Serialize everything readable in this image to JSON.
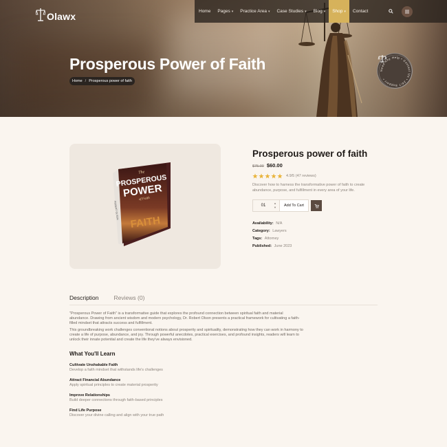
{
  "brand": {
    "name": "Olawx"
  },
  "nav": {
    "items": [
      {
        "label": "Home",
        "dropdown": false,
        "active": false
      },
      {
        "label": "Pages",
        "dropdown": true,
        "active": false
      },
      {
        "label": "Practice Area",
        "dropdown": true,
        "active": false
      },
      {
        "label": "Case Studies",
        "dropdown": true,
        "active": false
      },
      {
        "label": "Blog",
        "dropdown": true,
        "active": false
      },
      {
        "label": "Shop",
        "dropdown": true,
        "active": true
      },
      {
        "label": "Contact",
        "dropdown": false,
        "active": false
      }
    ],
    "search_icon": "search-icon",
    "menu_icon": "grid-menu-icon"
  },
  "hero": {
    "title": "Prosperous Power of Faith",
    "breadcrumb": {
      "home": "Home",
      "separator": "/",
      "current": "Prosperous power of faith"
    },
    "badge_text": "Need Any Help • Contact Us • 24/7 Support •"
  },
  "product": {
    "title": "Prosperous power of faith",
    "old_price": "$75.00",
    "new_price": "$60.00",
    "rating": {
      "stars": 5,
      "text": "4.9/5 (47 reviews)"
    },
    "description": "Discover how to harness the transformative power of faith to create abundance, purpose, and fulfillment in every area of your life.",
    "quantity": "01",
    "add_to_cart": "Add To Cart",
    "meta": {
      "availability": {
        "label": "Availability:",
        "value": "N/A"
      },
      "category": {
        "label": "Category:",
        "value": "Lawyers"
      },
      "tags": {
        "label": "Tags:",
        "value": "Attorney"
      },
      "published": {
        "label": "Published:",
        "value": "June 2023"
      }
    },
    "book": {
      "top": "The",
      "line1": "PROSPEROUS",
      "line2": "POWER",
      "line3": "of Faith",
      "line4": "FAITH",
      "side": "ROBERT OLSON"
    }
  },
  "tabs": [
    {
      "label": "Description",
      "active": true
    },
    {
      "label": "Reviews (0)",
      "active": false
    }
  ],
  "description": {
    "paragraphs": [
      "\"Prosperous Power of Faith\" is a transformative guide that explores the profound connection between spiritual faith and material abundance. Drawing from ancient wisdom and modern psychology, Dr. Robert Olson presents a practical framework for cultivating a faith-filled mindset that attracts success and fulfillment.",
      "This groundbreaking work challenges conventional notions about prosperity and spirituality, demonstrating how they can work in harmony to create a life of purpose, abundance, and joy. Through powerful anecdotes, practical exercises, and profound insights, readers will learn to unlock their innate potential and create the life they've always envisioned."
    ],
    "learn_heading": "What You'll Learn",
    "learn_items": [
      {
        "title": "Cultivate Unshakable Faith",
        "desc": "Develop a faith mindset that withstands life's challenges"
      },
      {
        "title": "Attract Financial Abundance",
        "desc": "Apply spiritual principles to create material prosperity"
      },
      {
        "title": "Improve Relationships",
        "desc": "Build deeper connections through faith-based principles"
      },
      {
        "title": "Find Life Purpose",
        "desc": "Discover your divine calling and align with your true path"
      }
    ]
  },
  "colors": {
    "accent": "#d6b25b",
    "page_bg": "#faf5ef",
    "card_bg": "#efe8e0",
    "dark": "#2a2420",
    "star": "#e9b43c"
  }
}
